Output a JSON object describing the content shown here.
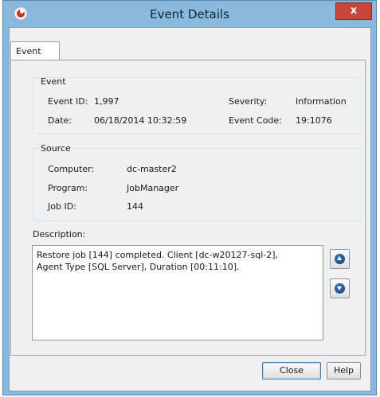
{
  "window": {
    "title": "Event Details",
    "close_glyph": "x"
  },
  "tabs": [
    {
      "label": "Event"
    }
  ],
  "event_group": {
    "title": "Event",
    "event_id_label": "Event ID:",
    "event_id": "1,997",
    "severity_label": "Severity:",
    "severity": "Information",
    "date_label": "Date:",
    "date": "06/18/2014 10:32:59",
    "event_code_label": "Event Code:",
    "event_code": "19:1076"
  },
  "source_group": {
    "title": "Source",
    "computer_label": "Computer:",
    "computer": "dc-master2",
    "program_label": "Program:",
    "program": "JobManager",
    "job_id_label": "Job ID:",
    "job_id": "144"
  },
  "description": {
    "label": "Description:",
    "text": "Restore job [144] completed. Client [dc-w20127-sql-2],\nAgent Type [SQL Server], Duration [00:11:10]."
  },
  "buttons": {
    "close": "Close",
    "help": "Help"
  },
  "icons": {
    "app": "app-logo-icon",
    "previous": "arrow-up-icon",
    "next": "arrow-down-icon"
  }
}
